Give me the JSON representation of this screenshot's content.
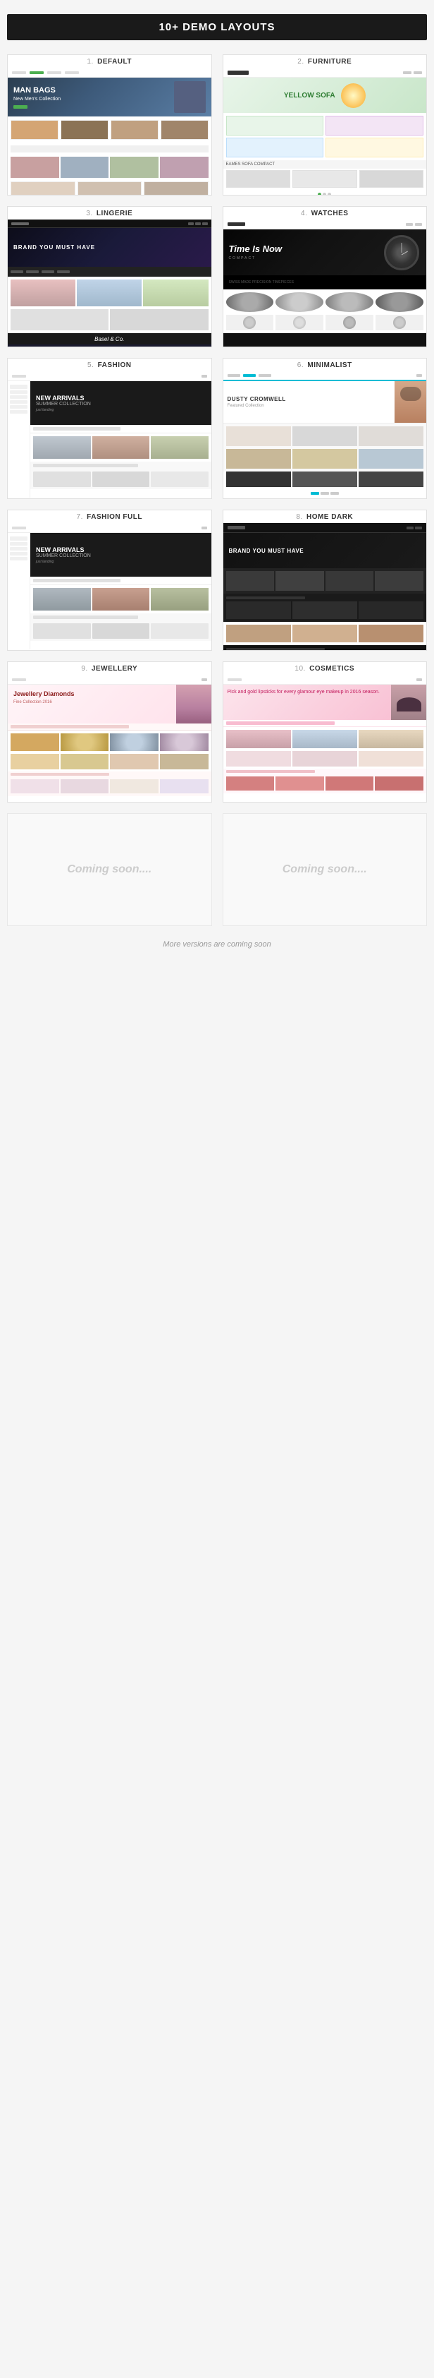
{
  "header": {
    "title": "10+ DEMO LAYOUTS"
  },
  "demos": [
    {
      "id": "default",
      "number": "1.",
      "name": "DEFAULT",
      "type": "default"
    },
    {
      "id": "furniture",
      "number": "2.",
      "name": "FURNITURE",
      "type": "furniture"
    },
    {
      "id": "lingerie",
      "number": "3.",
      "name": "LINGERIE",
      "type": "lingerie"
    },
    {
      "id": "watches",
      "number": "4.",
      "name": "WATCHES",
      "type": "watches"
    },
    {
      "id": "fashion",
      "number": "5.",
      "name": "FASHION",
      "type": "fashion"
    },
    {
      "id": "minimalist",
      "number": "6.",
      "name": "MINIMALIST",
      "type": "minimalist"
    },
    {
      "id": "fashion-full",
      "number": "7.",
      "name": "FASHION FULL",
      "type": "fashion-full"
    },
    {
      "id": "home-dark",
      "number": "8.",
      "name": "HOME DARK",
      "type": "home-dark"
    },
    {
      "id": "jewellery",
      "number": "9.",
      "name": "JEWELLERY",
      "type": "jewellery"
    },
    {
      "id": "cosmetics",
      "number": "10.",
      "name": "COSMETICS",
      "type": "cosmetics"
    }
  ],
  "coming_soon": [
    {
      "text": "Coming\nsoon...."
    },
    {
      "text": "Coming\nsoon...."
    }
  ],
  "footer": {
    "text": "More versions are coming soon"
  },
  "watches_hero_text": "Time Is Now",
  "watches_sub": "COMPACT",
  "default_hero_line1": "MAN BAGS",
  "default_hero_line2": "New Men's Collection",
  "furniture_hero_text": "YELLOW SOFA",
  "furniture_sub": "EAMES SOFA COMPACT",
  "lingerie_hero_text": "BRAND YOU MUST HAVE",
  "lingerie_logo": "Basel & Co.",
  "fashion_hero_line1": "NEW ARRIVALS",
  "fashion_hero_line2": "SUMMER COLLECTION",
  "minimalist_name": "DUSTY CROMWELL",
  "fashion_full_line1": "NEW ARRIVALS",
  "fashion_full_line2": "SUMMER COLLECTION",
  "home_dark_text": "BRAND YOU MUST HAVE",
  "jewellery_text": "Jewellery Diamonds",
  "cosmetics_text": "Pick and gold lipsticks for every glamour eye makeup in 2016 season."
}
